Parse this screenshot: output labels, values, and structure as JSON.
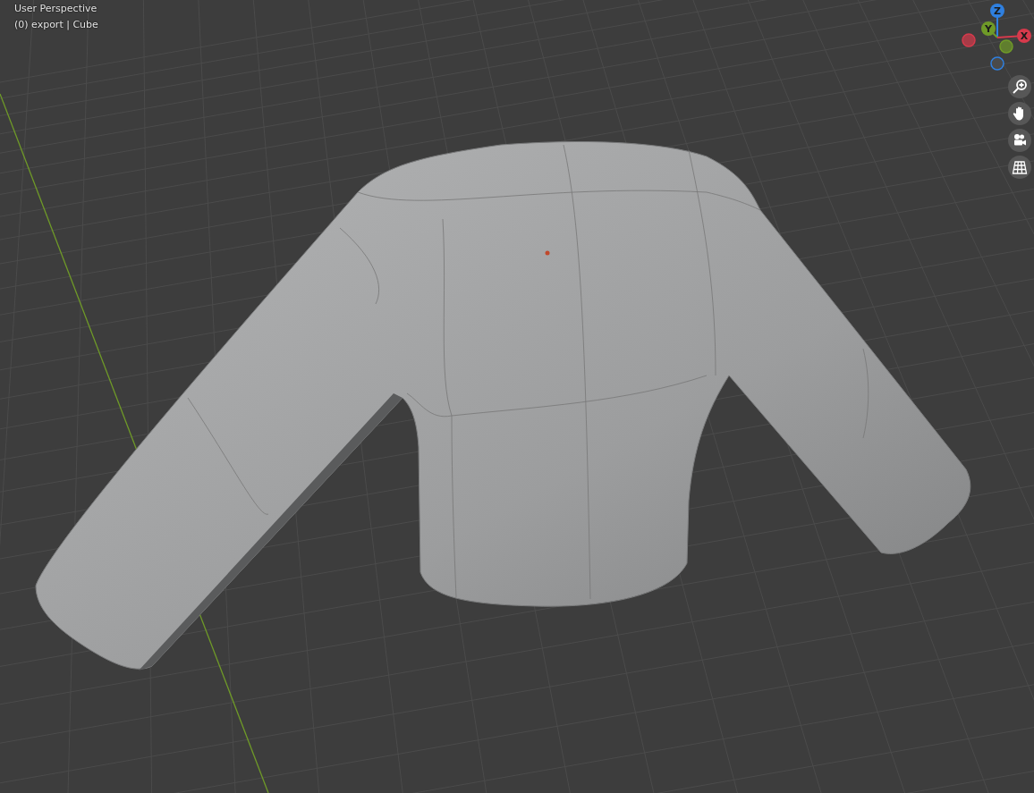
{
  "viewport": {
    "view_name": "User Perspective",
    "object_info": "(0) export | Cube"
  },
  "gizmo": {
    "axes": [
      {
        "label": "Z",
        "color": "#2f80e0"
      },
      {
        "label": "Y",
        "color": "#6f9a28"
      },
      {
        "label": "X",
        "color": "#d63a4c"
      }
    ]
  },
  "nav_buttons": [
    {
      "kind": "zoom"
    },
    {
      "kind": "pan"
    },
    {
      "kind": "camera"
    },
    {
      "kind": "grid"
    }
  ]
}
